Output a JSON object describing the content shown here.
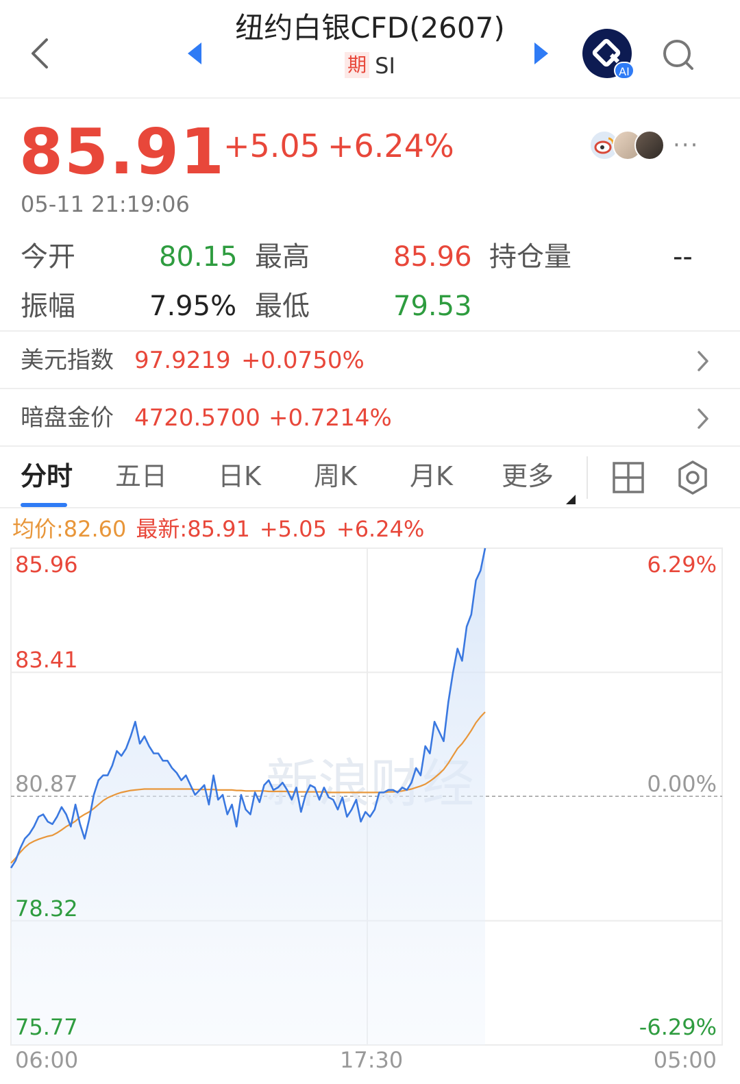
{
  "header": {
    "title": "纽约白银CFD(2607)",
    "badge": "期",
    "symbol": "SI",
    "ai_tag": "AI"
  },
  "quote": {
    "last": "85.91",
    "change": "+5.05",
    "change_pct": "+6.24%",
    "timestamp": "05-11 21:19:06",
    "more": "···"
  },
  "stats": {
    "open_label": "今开",
    "open": "80.15",
    "high_label": "最高",
    "high": "85.96",
    "oi_label": "持仓量",
    "oi": "--",
    "amp_label": "振幅",
    "amp": "7.95%",
    "low_label": "最低",
    "low": "79.53"
  },
  "related": [
    {
      "label": "美元指数",
      "value": "97.9219",
      "change": "+0.0750%"
    },
    {
      "label": "暗盘金价",
      "value": "4720.5700",
      "change": "+0.7214%"
    }
  ],
  "tabs": [
    "分时",
    "五日",
    "日K",
    "周K",
    "月K",
    "更多"
  ],
  "legend": {
    "avg": "均价:82.60",
    "latest": "最新:85.91",
    "change": "+5.05",
    "change_pct": "+6.24%"
  },
  "colors": {
    "up": "#e8473a",
    "down": "#2e9c3f",
    "price_line": "#3a78e0",
    "avg_line": "#e8963a",
    "accent": "#2f7bf5"
  },
  "chart_data": {
    "type": "line",
    "ylim": [
      75.77,
      85.96
    ],
    "prev_close": 80.87,
    "y_ticks_left": [
      "85.96",
      "83.41",
      "80.87",
      "78.32",
      "75.77"
    ],
    "y_ticks_right": [
      "6.29%",
      "",
      "0.00%",
      "",
      "-6.29%"
    ],
    "x_ticks": [
      "06:00",
      "17:30",
      "05:00"
    ],
    "grid": true,
    "series": [
      {
        "key": "price",
        "values": [
          79.4,
          79.55,
          79.8,
          80.0,
          80.1,
          80.25,
          80.45,
          80.5,
          80.35,
          80.3,
          80.45,
          80.65,
          80.5,
          80.25,
          80.7,
          80.3,
          80.0,
          80.4,
          80.9,
          81.2,
          81.3,
          81.3,
          81.5,
          81.8,
          81.7,
          81.85,
          82.1,
          82.4,
          81.95,
          82.1,
          81.9,
          81.75,
          81.75,
          81.6,
          81.6,
          81.45,
          81.35,
          81.2,
          81.3,
          81.1,
          80.9,
          81.0,
          81.1,
          80.7,
          81.3,
          80.8,
          80.9,
          80.5,
          80.7,
          80.25,
          80.9,
          80.6,
          80.5,
          80.95,
          80.75,
          81.1,
          81.2,
          81.0,
          81.05,
          81.15,
          81.0,
          80.8,
          81.05,
          80.55,
          80.9,
          81.1,
          81.05,
          80.8,
          81.05,
          80.85,
          80.8,
          80.6,
          80.85,
          80.45,
          80.6,
          80.8,
          80.35,
          80.55,
          80.45,
          80.6,
          80.95,
          80.95,
          81.0,
          81.0,
          80.95,
          81.05,
          81.0,
          81.15,
          81.45,
          81.3,
          81.9,
          81.75,
          82.4,
          82.2,
          82.0,
          82.8,
          83.4,
          83.9,
          83.65,
          84.35,
          84.6,
          85.3,
          85.5,
          85.96
        ]
      },
      {
        "key": "avg",
        "values": [
          79.5,
          79.6,
          79.72,
          79.82,
          79.9,
          79.95,
          79.99,
          80.02,
          80.05,
          80.07,
          80.12,
          80.18,
          80.25,
          80.3,
          80.36,
          80.44,
          80.5,
          80.55,
          80.62,
          80.7,
          80.78,
          80.84,
          80.88,
          80.92,
          80.95,
          80.97,
          80.99,
          81.0,
          81.01,
          81.02,
          81.02,
          81.02,
          81.02,
          81.02,
          81.02,
          81.02,
          81.02,
          81.02,
          81.02,
          81.02,
          81.01,
          81.01,
          81.01,
          81.01,
          81.01,
          81.0,
          81.0,
          81.0,
          81.0,
          80.99,
          80.99,
          80.98,
          80.98,
          80.98,
          80.98,
          80.98,
          80.97,
          80.97,
          80.97,
          80.97,
          80.97,
          80.96,
          80.96,
          80.96,
          80.96,
          80.96,
          80.96,
          80.96,
          80.96,
          80.95,
          80.95,
          80.95,
          80.95,
          80.95,
          80.95,
          80.95,
          80.95,
          80.95,
          80.95,
          80.95,
          80.95,
          80.95,
          80.96,
          80.96,
          80.97,
          80.98,
          81.0,
          81.02,
          81.05,
          81.08,
          81.12,
          81.18,
          81.25,
          81.33,
          81.42,
          81.55,
          81.7,
          81.85,
          81.95,
          82.08,
          82.22,
          82.38,
          82.5,
          82.6
        ]
      }
    ]
  }
}
